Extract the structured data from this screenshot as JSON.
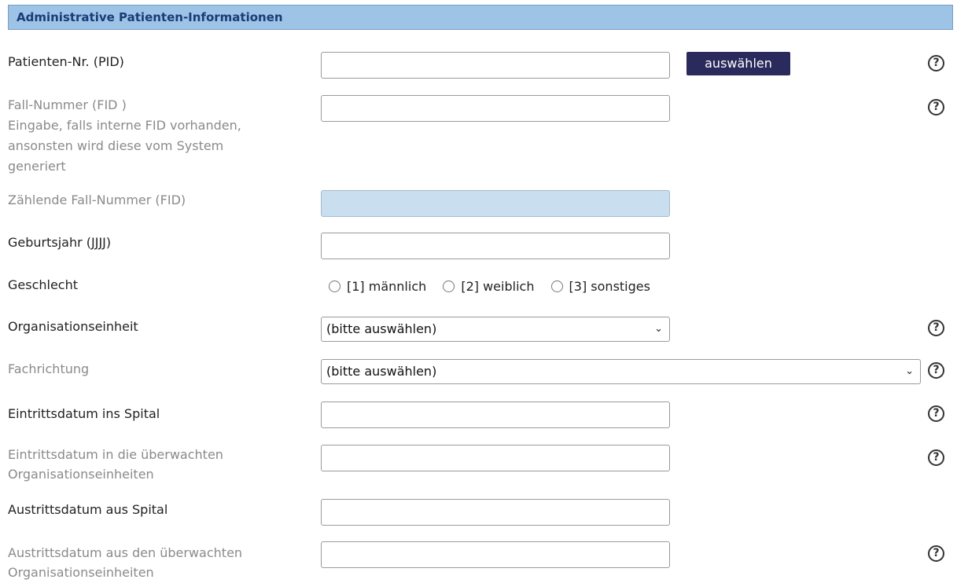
{
  "section_title": "Administrative Patienten-Informationen",
  "fields": {
    "pid_label": "Patienten-Nr. (PID)",
    "select_button": "auswählen",
    "fid_label_1": "Fall-Nummer (FID )",
    "fid_label_2": "Eingabe, falls interne FID vorhanden,",
    "fid_label_3": "ansonsten wird diese vom System",
    "fid_label_4": "generiert",
    "count_fid_label": "Zählende Fall-Nummer (FID)",
    "birth_label": "Geburtsjahr (JJJJ)",
    "gender_label": "Geschlecht",
    "gender_options": [
      "[1] männlich",
      "[2] weiblich",
      "[3] sonstiges"
    ],
    "org_label": "Organisationseinheit",
    "org_value": "(bitte auswählen)",
    "field_label": "Fachrichtung",
    "field_value": "(bitte auswählen)",
    "admission_label": "Eintrittsdatum ins Spital",
    "admission_units_1": "Eintrittsdatum in die überwachten",
    "admission_units_2": "Organisationseinheiten",
    "discharge_label": "Austrittsdatum aus Spital",
    "discharge_units_1": "Austrittsdatum aus den überwachten",
    "discharge_units_2": "Organisationseinheiten"
  },
  "help_symbol": "?"
}
